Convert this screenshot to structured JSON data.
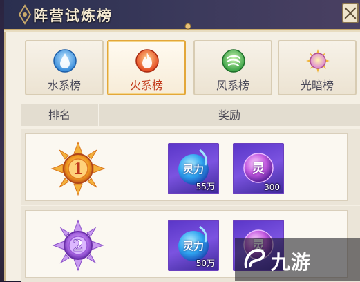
{
  "window": {
    "title": "阵营试炼榜"
  },
  "tabs": [
    {
      "label": "水系榜",
      "icon": "water-element-icon",
      "selected": false,
      "color": "#4aa9f0"
    },
    {
      "label": "火系榜",
      "icon": "fire-element-icon",
      "selected": true,
      "color": "#f05a1e"
    },
    {
      "label": "风系榜",
      "icon": "wind-element-icon",
      "selected": false,
      "color": "#3cb44a"
    },
    {
      "label": "光暗榜",
      "icon": "light-dark-element-icon",
      "selected": false,
      "color": "#f0a020"
    }
  ],
  "table": {
    "headers": {
      "rank": "排名",
      "reward": "奖励"
    },
    "rows": [
      {
        "rank": "1",
        "badge": "gold-rank-badge-icon",
        "rewards": [
          {
            "name": "灵力",
            "count": "55万",
            "icon": "spirit-power-orb-icon"
          },
          {
            "name": "灵",
            "count": "300",
            "icon": "spirit-crystal-icon"
          }
        ]
      },
      {
        "rank": "2",
        "badge": "purple-rank-badge-icon",
        "rewards": [
          {
            "name": "灵力",
            "count": "50万",
            "icon": "spirit-power-orb-icon"
          },
          {
            "name": "灵",
            "count": "",
            "icon": "spirit-crystal-icon"
          }
        ]
      }
    ]
  },
  "watermark": {
    "text": "九游"
  },
  "colors": {
    "accent": "#e3a73a",
    "selected_label": "#c23a1c",
    "item_frame": "#6a3fbf"
  }
}
